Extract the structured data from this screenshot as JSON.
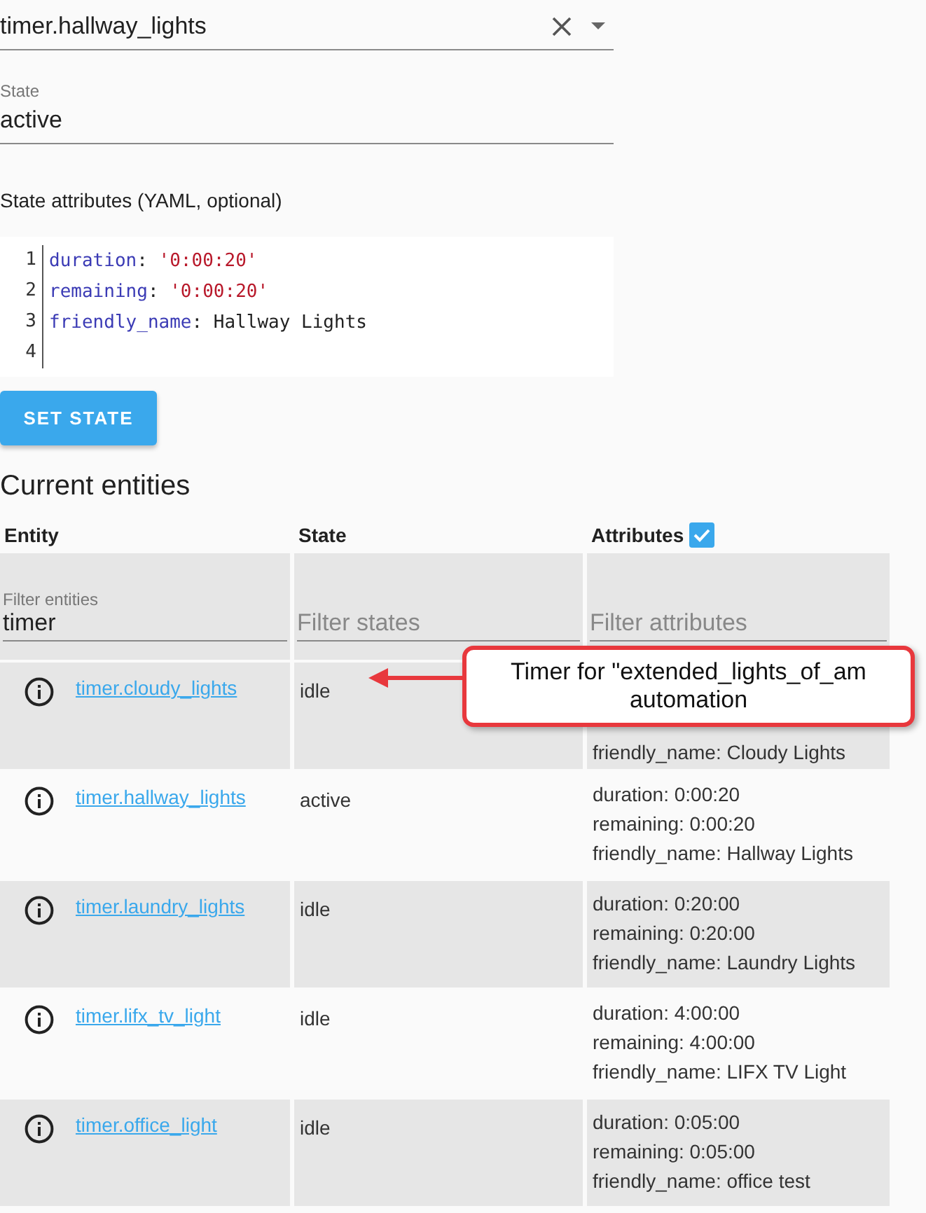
{
  "entity_field": {
    "value": "timer.hallway_lights"
  },
  "state_field": {
    "label": "State",
    "value": "active"
  },
  "attributes_label": "State attributes (YAML, optional)",
  "code_editor": {
    "lines": [
      {
        "number": "1",
        "tokens": [
          {
            "kind": "key",
            "text": "duration"
          },
          {
            "kind": "punct",
            "text": ": "
          },
          {
            "kind": "string",
            "text": "'0:00:20'"
          }
        ]
      },
      {
        "number": "2",
        "tokens": [
          {
            "kind": "key",
            "text": "remaining"
          },
          {
            "kind": "punct",
            "text": ": "
          },
          {
            "kind": "string",
            "text": "'0:00:20'"
          }
        ]
      },
      {
        "number": "3",
        "tokens": [
          {
            "kind": "key",
            "text": "friendly_name"
          },
          {
            "kind": "punct",
            "text": ": "
          },
          {
            "kind": "plain",
            "text": "Hallway Lights"
          }
        ]
      },
      {
        "number": "4"
      }
    ]
  },
  "set_state_button": "SET STATE",
  "section_title": "Current entities",
  "table": {
    "columns": [
      {
        "label": "Entity"
      },
      {
        "label": "State"
      },
      {
        "label": "Attributes",
        "checked": true
      }
    ],
    "filters": [
      {
        "label": "Filter entities",
        "value": "timer"
      },
      {
        "placeholder": "Filter states"
      },
      {
        "placeholder": "Filter attributes"
      }
    ],
    "rows": [
      {
        "entity": "timer.cloudy_lights",
        "state": "idle",
        "attributes": [
          "friendly_name: Cloudy Lights"
        ]
      },
      {
        "entity": "timer.hallway_lights",
        "state": "active",
        "attributes": [
          "duration: 0:00:20",
          "remaining: 0:00:20",
          "friendly_name: Hallway Lights"
        ]
      },
      {
        "entity": "timer.laundry_lights",
        "state": "idle",
        "attributes": [
          "duration: 0:20:00",
          "remaining: 0:20:00",
          "friendly_name: Laundry Lights"
        ]
      },
      {
        "entity": "timer.lifx_tv_light",
        "state": "idle",
        "attributes": [
          "duration: 4:00:00",
          "remaining: 4:00:00",
          "friendly_name: LIFX TV Light"
        ]
      },
      {
        "entity": "timer.office_light",
        "state": "idle",
        "attributes": [
          "duration: 0:05:00",
          "remaining: 0:05:00",
          "friendly_name: office test"
        ]
      }
    ]
  },
  "callout": {
    "text": "Timer for \"extended_lights_of_am automation"
  }
}
